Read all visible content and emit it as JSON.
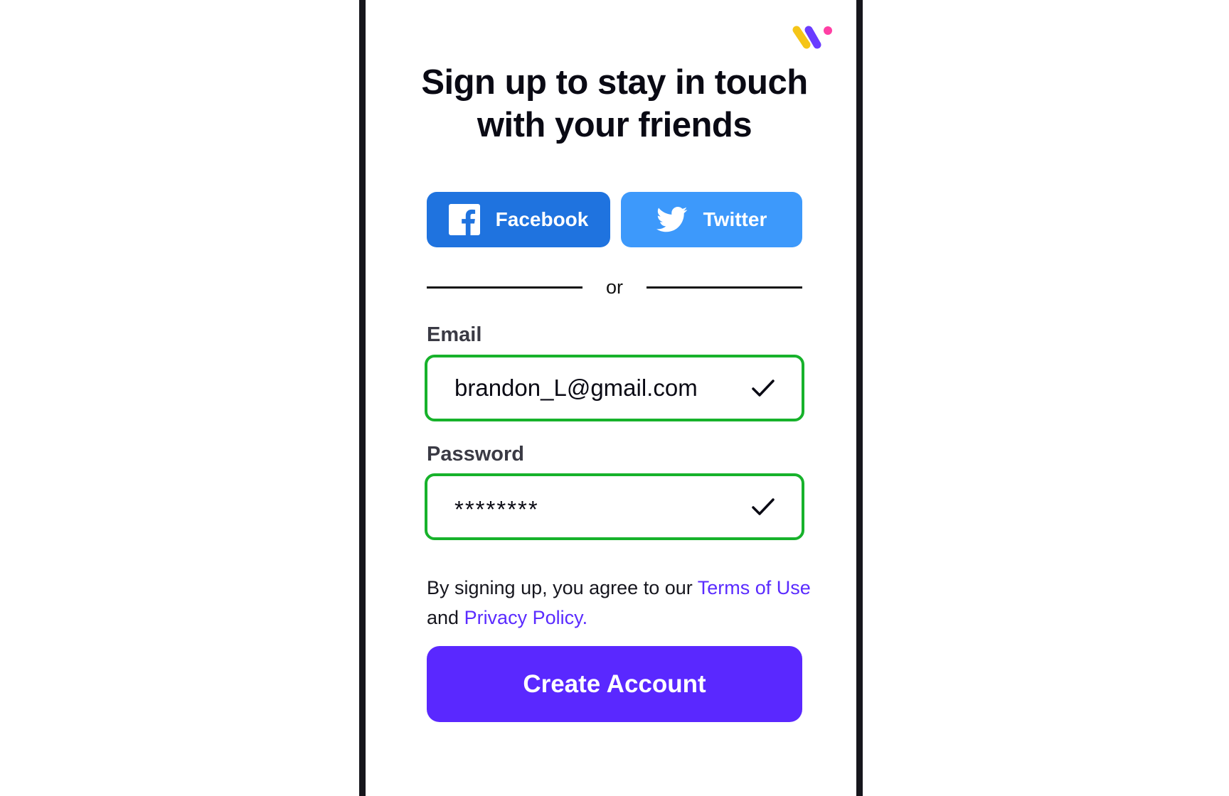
{
  "signup": {
    "title_line1": "Sign up to stay in touch",
    "title_line2": "with your friends",
    "social": {
      "facebook_label": "Facebook",
      "twitter_label": "Twitter"
    },
    "divider_text": "or",
    "email": {
      "label": "Email",
      "value": "brandon_L@gmail.com",
      "status_icon": "check-icon"
    },
    "password": {
      "label": "Password",
      "value": "********",
      "status_icon": "check-icon"
    },
    "terms": {
      "prefix": "By signing up, you agree to our ",
      "terms_link": "Terms of Use",
      "middle": " and ",
      "privacy_link": "Privacy Policy."
    },
    "create_button_label": "Create Account"
  },
  "colors": {
    "facebook": "#1f73df",
    "twitter": "#3d99fb",
    "valid_border": "#17b22b",
    "accent": "#5a28ff",
    "link": "#5a2bff",
    "logo_yellow": "#f5c518",
    "logo_purple": "#6a3cff",
    "logo_pink": "#ff3fa4"
  }
}
